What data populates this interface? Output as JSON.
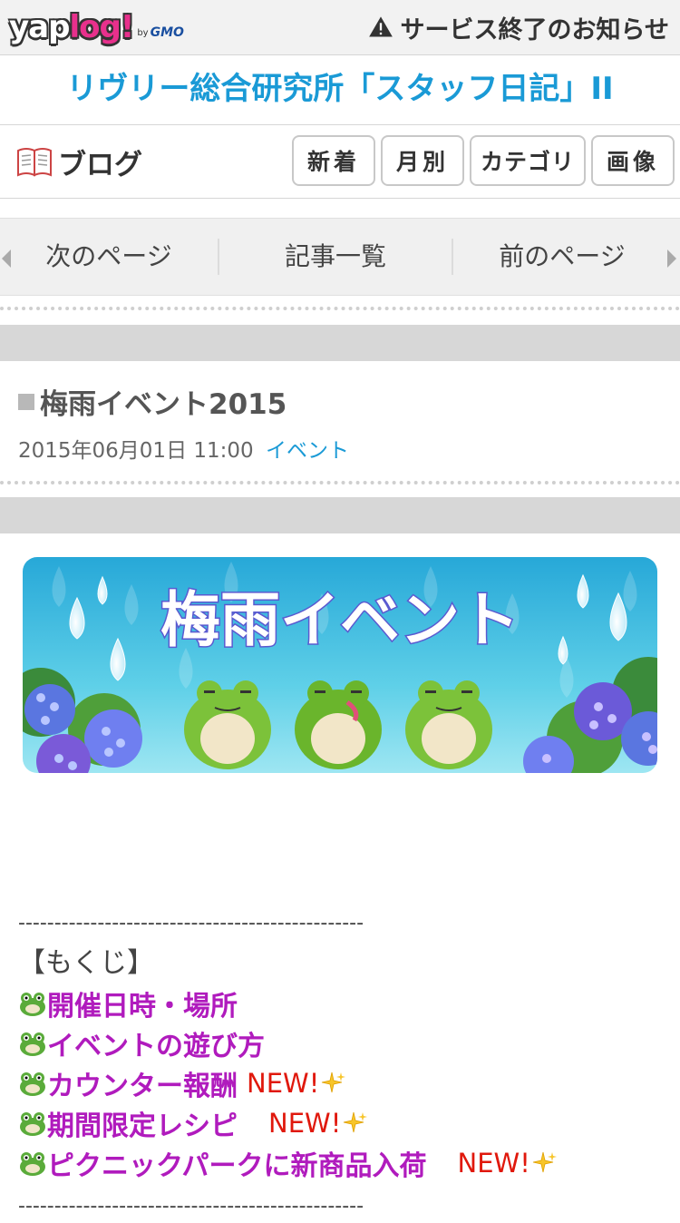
{
  "top_bar": {
    "logo_main": "yaplog!",
    "logo_by": "by",
    "logo_gmo": "GMO",
    "notice": "サービス終了のお知らせ"
  },
  "blog_title": "リヴリー総合研究所「スタッフ日記」II",
  "blog_menu": {
    "label": "ブログ",
    "buttons": [
      "新着",
      "月別",
      "カテゴリ",
      "画像"
    ]
  },
  "pager": {
    "next": "次のページ",
    "list": "記事一覧",
    "prev": "前のページ"
  },
  "entry": {
    "title": "梅雨イベント2015",
    "datetime": "2015年06月01日 11:00",
    "category": "イベント"
  },
  "banner": {
    "text": "梅雨イベント"
  },
  "content": {
    "rule": "------------------------------------------------",
    "toc_heading": "【もくじ】",
    "toc_items": [
      {
        "label": "開催日時・場所",
        "badge": ""
      },
      {
        "label": "イベントの遊び方",
        "badge": ""
      },
      {
        "label": "カウンター報酬",
        "badge": "NEW!"
      },
      {
        "label": "期間限定レシピ",
        "badge": "NEW!"
      },
      {
        "label": "ピクニックパークに新商品入荷",
        "badge": "NEW!"
      }
    ]
  },
  "colors": {
    "accent_blue": "#1a9ad6",
    "toc_purple": "#b01bbd",
    "new_red": "#e0180c"
  },
  "icons": [
    "warning-icon",
    "book-icon",
    "frog-icon",
    "sparkle-icon",
    "arrow-left-icon",
    "arrow-right-icon"
  ]
}
